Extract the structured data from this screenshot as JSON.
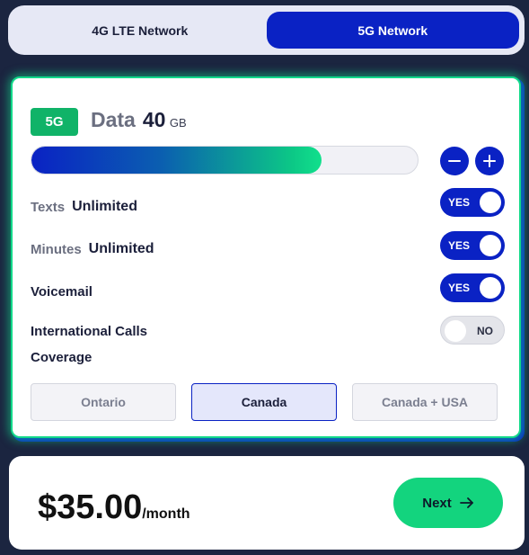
{
  "network_tabs": [
    {
      "label": "4G LTE Network",
      "active": false
    },
    {
      "label": "5G Network",
      "active": true
    }
  ],
  "plan": {
    "badge": "5G",
    "data_label": "Data",
    "data_amount": "40",
    "data_unit": "GB",
    "data_progress_fraction": 0.75,
    "features": [
      {
        "label": "Texts",
        "value": "Unlimited",
        "toggle": "YES",
        "enabled": true
      },
      {
        "label": "Minutes",
        "value": "Unlimited",
        "toggle": "YES",
        "enabled": true
      },
      {
        "label": "Voicemail",
        "value": "",
        "toggle": "YES",
        "enabled": true
      },
      {
        "label": "International Calls",
        "value": "",
        "toggle": "NO",
        "enabled": false
      }
    ],
    "coverage_title": "Coverage",
    "coverage_options": [
      {
        "label": "Ontario",
        "selected": false
      },
      {
        "label": "Canada",
        "selected": true
      },
      {
        "label": "Canada + USA",
        "selected": false
      }
    ]
  },
  "summary": {
    "price": "$35.00",
    "period": "/month",
    "next_label": "Next"
  },
  "icons": {
    "decrease": "minus-icon",
    "increase": "plus-icon",
    "next": "arrow-right-icon"
  },
  "colors": {
    "accent": "#0a22c4",
    "green": "#13d47e",
    "badge_green": "#10b368"
  }
}
